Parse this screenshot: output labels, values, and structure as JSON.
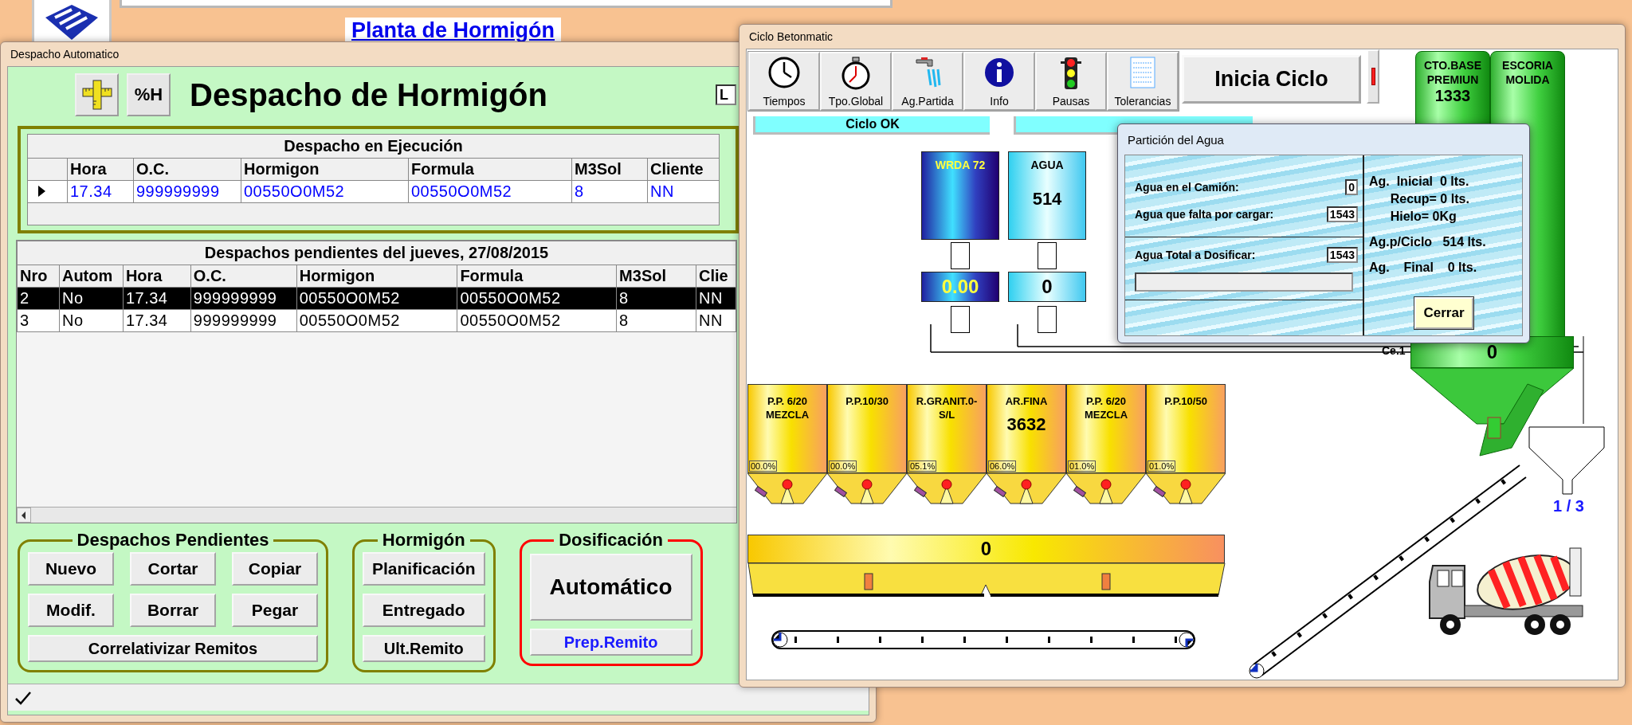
{
  "desktop": {
    "link": "Planta de Hormigón"
  },
  "despacho": {
    "title": "Despacho Automatico",
    "heading": "Despacho de Hormigón",
    "tool_buttons": [
      {
        "kind": "ruler"
      },
      {
        "kind": "text",
        "label": "%H"
      }
    ],
    "corner_field": "L",
    "running": {
      "title": "Despacho en Ejecución",
      "columns": [
        "Hora",
        "O.C.",
        "Hormigon",
        "Formula",
        "M3Sol",
        "Cliente"
      ],
      "rows": [
        {
          "current": true,
          "cells": [
            "17.34",
            "999999999",
            "00550O0M52",
            "00550O0M52",
            "8",
            "NN"
          ]
        }
      ]
    },
    "pending": {
      "title": "Despachos pendientes del jueves, 27/08/2015",
      "columns": [
        "Nro",
        "Autom",
        "Hora",
        "O.C.",
        "Hormigon",
        "Formula",
        "M3Sol",
        "Clie"
      ],
      "rows": [
        {
          "selected": true,
          "cells": [
            "2",
            "No",
            "17.34",
            "999999999",
            "00550O0M52",
            "00550O0M52",
            "8",
            "NN"
          ]
        },
        {
          "selected": false,
          "cells": [
            "3",
            "No",
            "17.34",
            "999999999",
            "00550O0M52",
            "00550O0M52",
            "8",
            "NN"
          ]
        }
      ]
    },
    "groups": [
      {
        "title": "Despachos Pendientes",
        "color": "#808000",
        "buttons": [
          {
            "label": "Nuevo",
            "kind": "normal"
          },
          {
            "label": "Cortar",
            "kind": "normal"
          },
          {
            "label": "Copiar",
            "kind": "normal"
          },
          {
            "label": "Modif.",
            "kind": "normal"
          },
          {
            "label": "Borrar",
            "kind": "normal"
          },
          {
            "label": "Pegar",
            "kind": "normal"
          },
          {
            "label": "Correlativizar Remitos",
            "kind": "wide"
          }
        ]
      },
      {
        "title": "Hormigón",
        "color": "#808000",
        "buttons": [
          {
            "label": "Planificación",
            "kind": "normal"
          },
          {
            "label": "Entregado",
            "kind": "normal"
          },
          {
            "label": "Ult.Remito",
            "kind": "small"
          }
        ]
      },
      {
        "title": "Dosificación",
        "color": "#ff0000",
        "buttons": [
          {
            "label": "Automático",
            "kind": "big"
          },
          {
            "label": "Prep.Remito",
            "kind": "link"
          }
        ]
      }
    ]
  },
  "ciclo": {
    "title": "Ciclo Betonmatic",
    "tools": [
      {
        "label": "Tiempos",
        "kind": "clock"
      },
      {
        "label": "Tpo.Global",
        "kind": "stopwatch"
      },
      {
        "label": "Ag.Partida",
        "kind": "tap"
      },
      {
        "label": "Info",
        "kind": "info"
      },
      {
        "label": "Pausas",
        "kind": "traffic"
      },
      {
        "label": "Tolerancias",
        "kind": "notepad"
      }
    ],
    "start_button": "Inicia Ciclo",
    "status": "Ciclo OK",
    "silos": [
      {
        "label": "CTO.BASE\nPREMIUN",
        "value": "1333"
      },
      {
        "label": "ESCORIA\nMOLIDA"
      }
    ],
    "tanks": [
      {
        "kind": "additive",
        "label": "WRDA 72",
        "reading": "0.00"
      },
      {
        "kind": "water",
        "label": "AGUA",
        "value": "514",
        "reading": "0"
      }
    ],
    "mixer": {
      "label": "Ce.1",
      "value": "0"
    },
    "bins": [
      {
        "label": "P.P. 6/20\nMEZCLA",
        "percent": "00.0%"
      },
      {
        "label": "P.P.10/30",
        "percent": "00.0%"
      },
      {
        "label": "R.GRANIT.0-\nS/L",
        "percent": "05.1%"
      },
      {
        "label": "AR.FINA",
        "value": "3632",
        "percent": "06.0%"
      },
      {
        "label": "P.P. 6/20\nMEZCLA",
        "percent": "01.0%"
      },
      {
        "label": "P.P.10/50",
        "percent": "01.0%"
      }
    ],
    "weigh_bin": "0",
    "skip_reading": "1 / 3"
  },
  "dialog": {
    "title": "Partición del Agua",
    "fields": [
      {
        "label": "Agua en el Camión:",
        "value": "0"
      },
      {
        "label": "Agua que falta por cargar:",
        "value": "1543"
      }
    ],
    "total": {
      "label": "Agua Total a Dosificar:",
      "value": "1543",
      "level": 0
    },
    "summary": [
      "Ag.  Inicial  0 lts.",
      "      Recup= 0 lts.",
      "      Hielo= 0Kg",
      "Ag.p/Ciclo   514 lts.",
      "Ag.    Final    0 lts."
    ],
    "button": "Cerrar"
  }
}
